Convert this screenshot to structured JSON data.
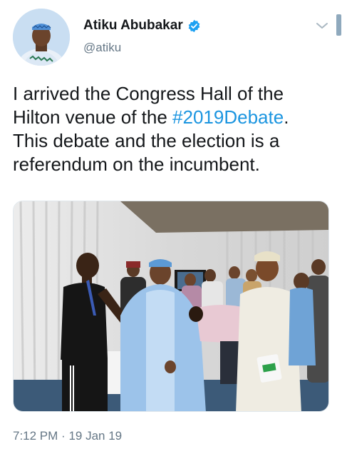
{
  "author": {
    "display_name": "Atiku Abubakar",
    "handle": "@atiku",
    "verified": true,
    "avatar_icon": "profile-photo"
  },
  "tweet": {
    "text_before_hashtag": "I arrived the Congress Hall of the Hilton venue of the ",
    "hashtag": "#2019Debate",
    "text_after_hashtag": ".\nThis debate and the election is a referendum on the incumbent."
  },
  "media": {
    "icon": "photo"
  },
  "timestamp": {
    "time": "7:12 PM",
    "separator": "·",
    "date": "19 Jan 19"
  },
  "colors": {
    "hashtag": "#1b95e0",
    "verified_badge": "#1da1f2",
    "secondary_text": "#657786"
  },
  "icons": {
    "verified": "verified-badge-icon",
    "menu": "chevron-down-icon"
  }
}
